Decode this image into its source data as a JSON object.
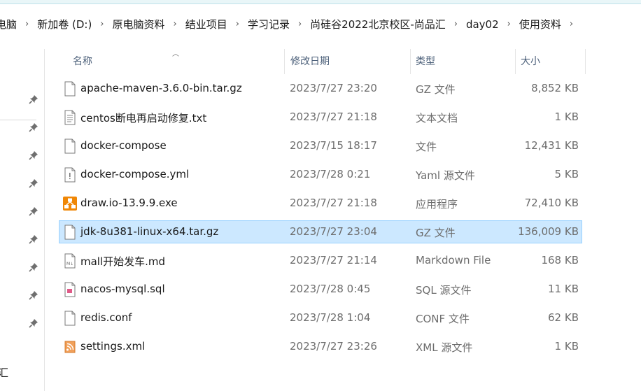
{
  "breadcrumb": [
    "电脑",
    "新加卷 (D:)",
    "原电脑资料",
    "结业项目",
    "学习记录",
    "尚硅谷2022北京校区-尚品汇",
    "day02",
    "使用资料"
  ],
  "columns": {
    "name": "名称",
    "date": "修改日期",
    "type": "类型",
    "size": "大小"
  },
  "nav": {
    "partial_label": "汇"
  },
  "files": [
    {
      "name": "apache-maven-3.6.0-bin.tar.gz",
      "date": "2023/7/27 23:20",
      "type": "GZ 文件",
      "size": "8,852 KB",
      "icon": "file-icon",
      "selected": false
    },
    {
      "name": "centos断电再启动修复.txt",
      "date": "2023/7/27 21:18",
      "type": "文本文档",
      "size": "1 KB",
      "icon": "text-file-icon",
      "selected": false
    },
    {
      "name": "docker-compose",
      "date": "2023/7/15 18:17",
      "type": "文件",
      "size": "12,431 KB",
      "icon": "file-icon",
      "selected": false
    },
    {
      "name": "docker-compose.yml",
      "date": "2023/7/28 0:21",
      "type": "Yaml 源文件",
      "size": "5 KB",
      "icon": "yaml-file-icon",
      "selected": false
    },
    {
      "name": "draw.io-13.9.9.exe",
      "date": "2023/7/27 21:18",
      "type": "应用程序",
      "size": "72,410 KB",
      "icon": "drawio-app-icon",
      "selected": false
    },
    {
      "name": "jdk-8u381-linux-x64.tar.gz",
      "date": "2023/7/27 23:04",
      "type": "GZ 文件",
      "size": "136,009 KB",
      "icon": "file-icon",
      "selected": true
    },
    {
      "name": "mall开始发车.md",
      "date": "2023/7/27 21:14",
      "type": "Markdown File",
      "size": "168 KB",
      "icon": "markdown-file-icon",
      "selected": false
    },
    {
      "name": "nacos-mysql.sql",
      "date": "2023/7/28 0:45",
      "type": "SQL 源文件",
      "size": "11 KB",
      "icon": "sql-file-icon",
      "selected": false
    },
    {
      "name": "redis.conf",
      "date": "2023/7/28 1:04",
      "type": "CONF 文件",
      "size": "62 KB",
      "icon": "file-icon",
      "selected": false
    },
    {
      "name": "settings.xml",
      "date": "2023/7/27 23:26",
      "type": "XML 源文件",
      "size": "1 KB",
      "icon": "xml-file-icon",
      "selected": false
    }
  ],
  "colors": {
    "selected_bg": "#cce8ff",
    "selected_border": "#99d1ff",
    "header_text": "#4c607a"
  }
}
